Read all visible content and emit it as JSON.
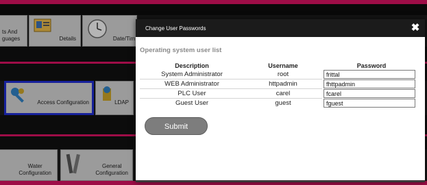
{
  "background": {
    "tiles": {
      "lang": "ts And\nguages",
      "details": "Details",
      "datetime": "Date/Tim",
      "access": "Access Configuration",
      "ldap": "LDAP",
      "water": "Water\nConfiguration",
      "general": "General\nConfiguration"
    }
  },
  "dialog": {
    "title": "Change User Passwords",
    "close_symbol": "✖",
    "section_title": "Operating system user list",
    "columns": [
      "Description",
      "Username",
      "Password"
    ],
    "rows": [
      {
        "description": "System Administrator",
        "username": "root",
        "password": "frittal"
      },
      {
        "description": "WEB Administrator",
        "username": "httpadmin",
        "password": "fhttpadmin"
      },
      {
        "description": "PLC User",
        "username": "carel",
        "password": "fcarel"
      },
      {
        "description": "Guest User",
        "username": "guest",
        "password": "fguest"
      }
    ],
    "submit_label": "Submit"
  },
  "colors": {
    "accent_pink": "#d3125f",
    "selection_blue": "#1f2ccf"
  }
}
